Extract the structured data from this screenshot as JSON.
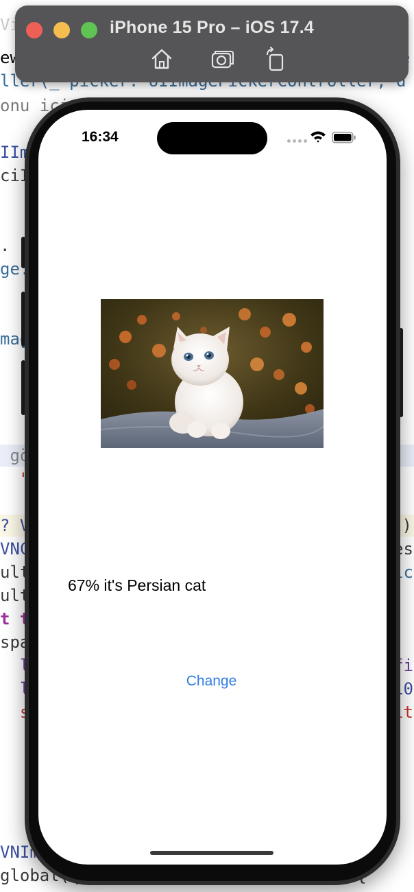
{
  "simulator": {
    "title": "iPhone 15 Pro – iOS 17.4",
    "toolbar_icons": [
      "home-icon",
      "screenshot-icon",
      "rotate-icon"
    ],
    "traffic_lights": {
      "close": "#ee5f57",
      "minimize": "#f5bd4f",
      "zoom": "#5fc454"
    }
  },
  "editor": {
    "lines": [
      {
        "text": "Vi",
        "color": "#c9c9c9"
      },
      {
        "text": "ew",
        "color": "#3a7ab0"
      },
      {
        "text": "ller(_ picker: UIImagePickerController, d",
        "color": "#3a6f9c"
      },
      {
        "text": "onu ici",
        "color": "#7a7a7a"
      },
      {
        "text": "IIm",
        "color": "#3a4fa0"
      },
      {
        "text": "ciI",
        "color": "#3a3a3a"
      },
      {
        "text": ".",
        "color": "#3a3a3a"
      },
      {
        "text": "ge.",
        "color": "#3a6f9c"
      },
      {
        "text": "mag",
        "color": "#3a6f9c"
      },
      {
        "text": " gö",
        "color": "#8a8a8a"
      },
      {
        "text": "  \"F",
        "color": "#c0392b"
      },
      {
        "text": "? V",
        "color": "#3a4fa0"
      },
      {
        "text": "VNC",
        "color": "#3a4fa0"
      },
      {
        "text": "ult",
        "color": "#3a3a3a"
      },
      {
        "text": "ult",
        "color": "#3a3a3a"
      },
      {
        "text": "t t",
        "color": "#9b2f9b"
      },
      {
        "text": "spa",
        "color": "#3a3a3a"
      },
      {
        "text": "  l",
        "color": "#6b3fa0"
      },
      {
        "text": "  l",
        "color": "#6b3fa0"
      },
      {
        "text": "  s",
        "color": "#c0392b"
      },
      {
        "text": "VNIma",
        "color": "#3a4fa0"
      },
      {
        "text": "global(qos: .userInteractive).async {",
        "color": "#3a3a3a"
      }
    ],
    "right_fragments": [
      {
        "text": "e",
        "color": "#3a6f9c"
      },
      {
        "text": "l)",
        "color": "#3a3a3a"
      },
      {
        "text": "es",
        "color": "#3a3a3a"
      },
      {
        "text": "ic",
        "color": "#3a6f9c"
      },
      {
        "text": "fi",
        "color": "#6b3fa0"
      },
      {
        "text": "10",
        "color": "#3a4fa0"
      },
      {
        "text": "it",
        "color": "#c0392b"
      }
    ]
  },
  "status_bar": {
    "time": "16:34"
  },
  "app": {
    "result_text": "67% it's Persian cat",
    "change_button": "Change"
  },
  "colors": {
    "link_blue": "#2f7de1",
    "phone_frame": "#2c2c2e"
  }
}
